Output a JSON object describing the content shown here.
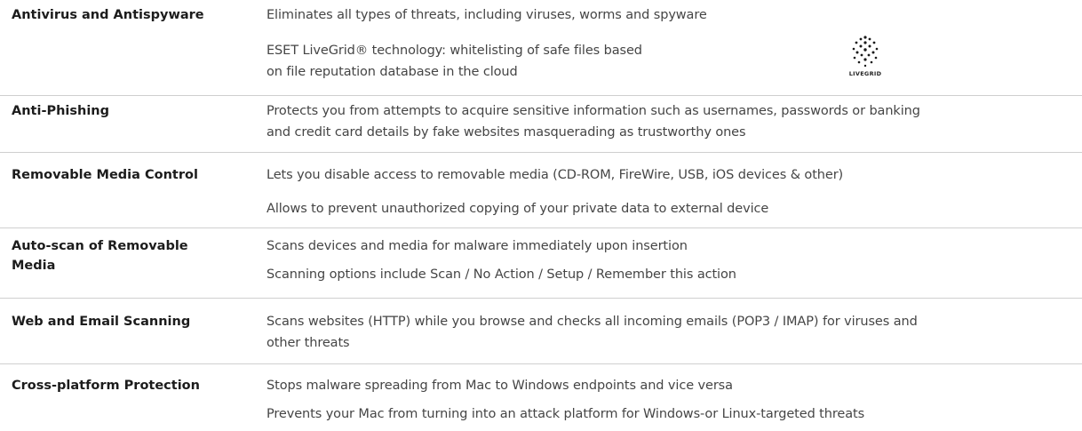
{
  "rows": [
    {
      "feature": "Antivirus and Antispyware",
      "descriptions": [
        "Eliminates all types of threats, including viruses, worms and spyware",
        "ESET LiveGrid® technology: whitelisting of safe files based",
        "on file reputation database in the cloud"
      ],
      "logo_text": "LIVEGRID",
      "logo_icon": "livegrid-dots-icon"
    },
    {
      "feature": "Anti-Phishing",
      "descriptions": [
        "Protects you from attempts to acquire sensitive information such as usernames, passwords or banking",
        "and credit card details by fake websites masquerading as trustworthy ones"
      ]
    },
    {
      "feature": "Removable Media Control",
      "descriptions": [
        "Lets you disable access to removable  media (CD-ROM, FireWire, USB, iOS devices & other)",
        "Allows to prevent unauthorized copying of your private data to external device"
      ]
    },
    {
      "feature_lines": [
        "Auto-scan of Removable",
        "Media"
      ],
      "descriptions": [
        "Scans devices and media for malware immediately upon insertion",
        "Scanning options include Scan / No Action /  Setup / Remember this action"
      ]
    },
    {
      "feature": "Web and Email Scanning",
      "descriptions": [
        "Scans websites (HTTP) while you browse and checks all incoming emails (POP3 / IMAP) for viruses and",
        "other threats"
      ]
    },
    {
      "feature": "Cross-platform Protection",
      "descriptions": [
        "Stops malware spreading from Mac to Windows endpoints and vice versa",
        "Prevents your Mac from turning into an attack platform for Windows-or Linux-targeted threats"
      ]
    }
  ]
}
